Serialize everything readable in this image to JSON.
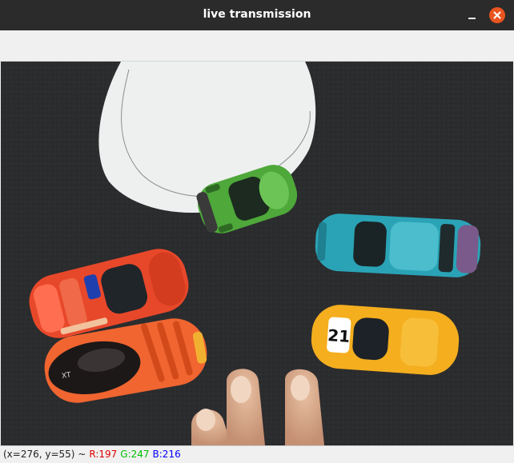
{
  "window": {
    "title": "live transmission",
    "controls": {
      "minimize_icon": "minimize-icon",
      "close_icon": "close-icon"
    }
  },
  "colors": {
    "titlebar": "#2b2b2b",
    "close_button": "#e95420",
    "status_r": "#e00000",
    "status_g": "#00c000",
    "status_b": "#0000ff"
  },
  "video": {
    "content": [
      "paper-circle",
      "green-car",
      "blue-car",
      "red-car",
      "orange-car",
      "yellow-car-number-21",
      "fingers"
    ],
    "yellow_car_number": "21"
  },
  "status": {
    "coords": "(x=276, y=55) ~",
    "r": "R:197",
    "g": "G:247",
    "b": "B:216"
  }
}
